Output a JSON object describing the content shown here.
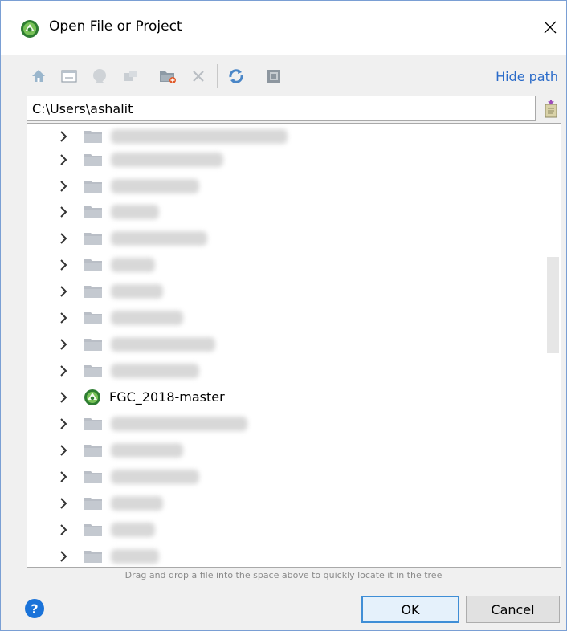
{
  "window": {
    "title": "Open File or Project"
  },
  "toolbar": {
    "buttons": [
      "home-icon",
      "desktop-icon",
      "project-icon",
      "module-icon",
      "new-folder-icon",
      "delete-icon",
      "refresh-icon",
      "show-hidden-icon"
    ],
    "hide_path_label": "Hide path"
  },
  "path": {
    "value": "C:\\Users\\ashalit"
  },
  "tree": {
    "project_item_label": "FGC_2018-master"
  },
  "hint": {
    "text": "Drag and drop a file into the space above to quickly locate it in the tree"
  },
  "buttons": {
    "help": "?",
    "ok": "OK",
    "cancel": "Cancel"
  },
  "colors": {
    "accent": "#2a6bc9",
    "help": "#1a73d9",
    "folder": "#b9bec6",
    "android_green": "#78c257"
  }
}
